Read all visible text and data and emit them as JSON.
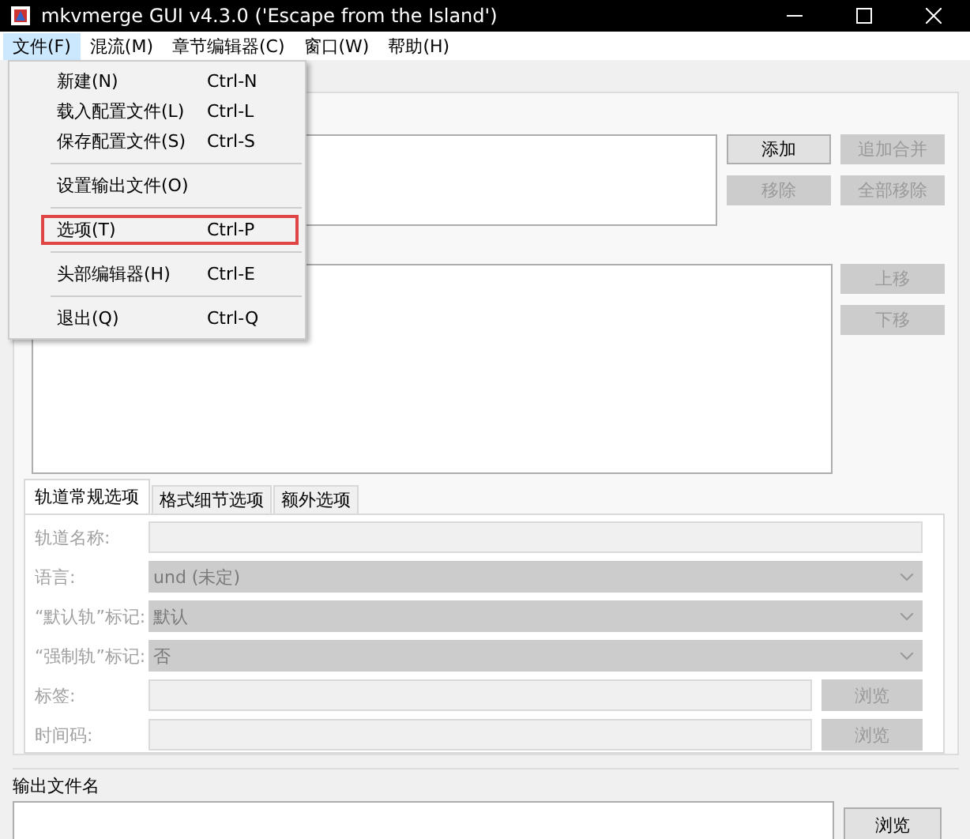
{
  "window": {
    "title": "mkvmerge GUI v4.3.0 ('Escape from the Island')"
  },
  "menu_bar": [
    {
      "label": "文件(F)",
      "selected": true
    },
    {
      "label": "混流(M)",
      "selected": false
    },
    {
      "label": "章节编辑器(C)",
      "selected": false
    },
    {
      "label": "窗口(W)",
      "selected": false
    },
    {
      "label": "帮助(H)",
      "selected": false
    }
  ],
  "file_menu": [
    {
      "kind": "item",
      "label": "新建(N)",
      "shortcut": "Ctrl-N",
      "highlighted": false
    },
    {
      "kind": "item",
      "label": "载入配置文件(L)",
      "shortcut": "Ctrl-L",
      "highlighted": false
    },
    {
      "kind": "item",
      "label": "保存配置文件(S)",
      "shortcut": "Ctrl-S",
      "highlighted": false
    },
    {
      "kind": "separator"
    },
    {
      "kind": "item",
      "label": "设置输出文件(O)",
      "highlighted": false
    },
    {
      "kind": "separator"
    },
    {
      "kind": "item",
      "label": "选项(T)",
      "shortcut": "Ctrl-P",
      "highlighted": true
    },
    {
      "kind": "separator"
    },
    {
      "kind": "item",
      "label": "头部编辑器(H)",
      "shortcut": "Ctrl-E",
      "highlighted": false
    },
    {
      "kind": "separator"
    },
    {
      "kind": "item",
      "label": "退出(Q)",
      "shortcut": "Ctrl-Q",
      "highlighted": false
    }
  ],
  "input_files": {
    "buttons": [
      {
        "label": "添加",
        "disabled": false
      },
      {
        "label": "追加合并",
        "disabled": true
      },
      {
        "label": "移除",
        "disabled": true
      },
      {
        "label": "全部移除",
        "disabled": true
      }
    ]
  },
  "tracks": {
    "buttons": [
      {
        "label": "上移",
        "disabled": true
      },
      {
        "label": "下移",
        "disabled": true
      }
    ]
  },
  "track_tabs": [
    {
      "label": "轨道常规选项",
      "selected": true
    },
    {
      "label": "格式细节选项",
      "selected": false
    },
    {
      "label": "额外选项",
      "selected": false
    }
  ],
  "track_options": [
    {
      "kind": "text",
      "label": "轨道名称:",
      "disabled": true
    },
    {
      "kind": "select",
      "label": "语言:",
      "value": "und (未定)",
      "disabled": true
    },
    {
      "kind": "select",
      "label": "“默认轨”标记:",
      "value": "默认",
      "disabled": true
    },
    {
      "kind": "select",
      "label": "“强制轨”标记:",
      "value": "否",
      "disabled": true
    },
    {
      "kind": "browse",
      "label": "标签:",
      "button": "浏览",
      "disabled": true
    },
    {
      "kind": "browse",
      "label": "时间码:",
      "button": "浏览",
      "disabled": true
    }
  ],
  "output": {
    "label": "输出文件名",
    "button": "浏览"
  }
}
